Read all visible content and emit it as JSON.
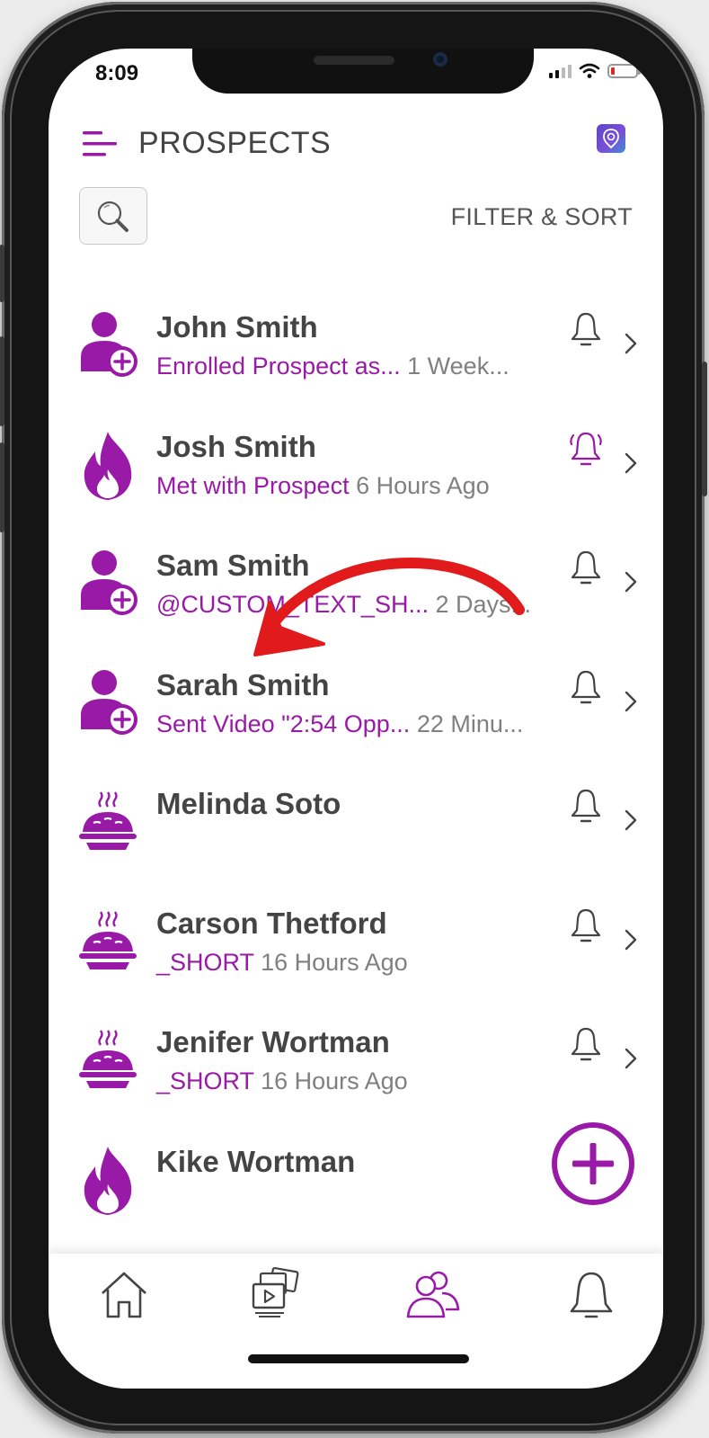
{
  "status_bar": {
    "time": "8:09"
  },
  "header": {
    "title": "PROSPECTS",
    "filter_label": "FILTER & SORT"
  },
  "colors": {
    "accent": "#9a1aa8",
    "name_text": "#444444",
    "time_text": "#808080",
    "annotation_arrow": "#e11b1b"
  },
  "prospects": [
    {
      "name": "John Smith",
      "activity": "Enrolled Prospect as...",
      "time": "1 Week...",
      "avatar_icon": "person-add-icon",
      "alert_active": false
    },
    {
      "name": "Josh Smith",
      "activity": "Met with Prospect",
      "time": "6 Hours Ago",
      "avatar_icon": "fire-icon",
      "alert_active": true
    },
    {
      "name": "Sam Smith",
      "activity": "@CUSTOM_TEXT_SH...",
      "time": "2 Days...",
      "avatar_icon": "person-add-icon",
      "alert_active": false
    },
    {
      "name": "Sarah Smith",
      "activity": "Sent Video \"2:54 Opp...",
      "time": "22 Minu...",
      "avatar_icon": "person-add-icon",
      "alert_active": false
    },
    {
      "name": "Melinda Soto",
      "activity": "",
      "time": "",
      "avatar_icon": "pie-icon",
      "alert_active": false
    },
    {
      "name": "Carson Thetford",
      "activity": "_SHORT",
      "time": "16 Hours Ago",
      "avatar_icon": "pie-icon",
      "alert_active": false
    },
    {
      "name": "Jenifer Wortman",
      "activity": "_SHORT",
      "time": "16 Hours Ago",
      "avatar_icon": "pie-icon",
      "alert_active": false
    },
    {
      "name": "Kike Wortman",
      "activity": "",
      "time": "",
      "avatar_icon": "fire-icon",
      "alert_active": false
    }
  ],
  "tab_bar": [
    {
      "icon": "home-icon",
      "active": false
    },
    {
      "icon": "media-library-icon",
      "active": false
    },
    {
      "icon": "prospects-icon",
      "active": true
    },
    {
      "icon": "notifications-bell-icon",
      "active": false
    }
  ]
}
